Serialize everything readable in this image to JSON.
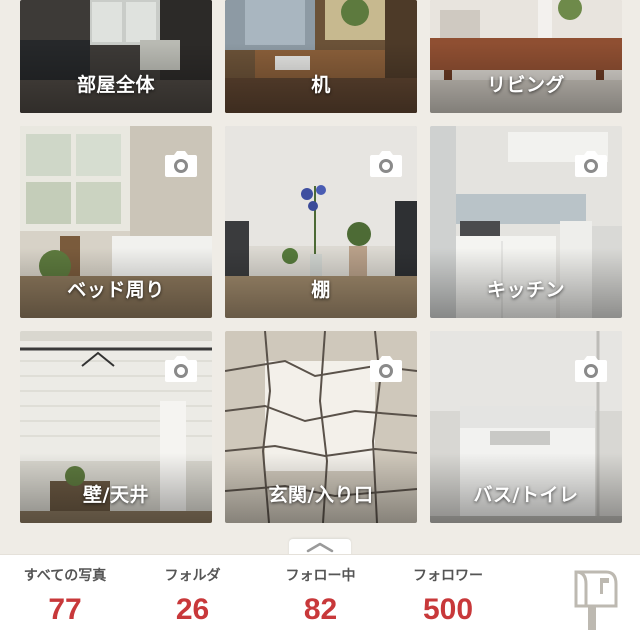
{
  "folders": [
    {
      "label": "部屋全体",
      "camera": false
    },
    {
      "label": "机",
      "camera": false
    },
    {
      "label": "リビング",
      "camera": false
    },
    {
      "label": "ベッド周り",
      "camera": true
    },
    {
      "label": "棚",
      "camera": true
    },
    {
      "label": "キッチン",
      "camera": true
    },
    {
      "label": "壁/天井",
      "camera": true
    },
    {
      "label": "玄関/入り口",
      "camera": true
    },
    {
      "label": "バス/トイレ",
      "camera": true
    }
  ],
  "stats": {
    "photos": {
      "label": "すべての写真",
      "value": "77"
    },
    "folders": {
      "label": "フォルダ",
      "value": "26"
    },
    "following": {
      "label": "フォロー中",
      "value": "82"
    },
    "followers": {
      "label": "フォロワー",
      "value": "500"
    }
  },
  "icons": {
    "camera": "camera-icon",
    "mailbox": "mailbox-icon",
    "handle": "chevron-up-icon"
  },
  "colors": {
    "accent": "#c8383a",
    "background": "#efece6"
  }
}
